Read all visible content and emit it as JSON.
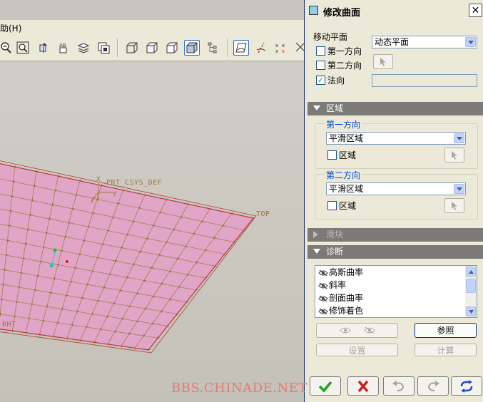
{
  "menubar": {
    "help_menu": "助(H)"
  },
  "toolbar": {
    "icons": [
      "zoom-out-icon",
      "zoom-window-icon",
      "reorient-icon",
      "named-views-icon",
      "layers-icon",
      "view-manager-icon",
      "wireframe-icon",
      "hidden-line-icon",
      "no-hidden-icon",
      "shading-icon",
      "model-tree-icon",
      "datum-planes-icon",
      "datum-axes-icon",
      "datum-points-icon",
      "coordinate-system-icon"
    ],
    "active": "shading-icon"
  },
  "viewport": {
    "labels": {
      "csys": "PRT_CSYS_DEF",
      "top": "TOP",
      "right_partial": "RHT",
      "csys_x": "X",
      "csys_z": "Z",
      "csys_y": "Y"
    },
    "surface_color": "#e0a5c7",
    "edge_color": "#b53b3b"
  },
  "watermark": "BBS.CHINADE.NET",
  "dialog": {
    "title": "修改曲面",
    "move_plane": {
      "label": "移动平面",
      "selected": "动态平面",
      "options": [
        {
          "label": "第一方向",
          "checked": false
        },
        {
          "label": "第二方向",
          "checked": false
        },
        {
          "label": "法向",
          "checked": true
        }
      ]
    },
    "region_section": {
      "title": "区域",
      "expanded": true,
      "dir1": {
        "title": "第一方向",
        "selected": "平滑区域",
        "checkbox_label": "区域",
        "checked": false
      },
      "dir2": {
        "title": "第二方向",
        "selected": "平滑区域",
        "checkbox_label": "区域",
        "checked": false
      }
    },
    "slider_section": {
      "title": "滑块",
      "expanded": false,
      "enabled": false
    },
    "diagnostics_section": {
      "title": "诊断",
      "expanded": true,
      "items": [
        "高斯曲率",
        "斜率",
        "剖面曲率",
        "修饰着色"
      ],
      "buttons": {
        "reference": "参照",
        "settings": "设置",
        "compute": "计算"
      }
    },
    "footer_buttons": [
      "ok-check-icon",
      "cancel-x-icon",
      "undo-icon",
      "redo-icon",
      "refresh-icon"
    ],
    "colors": {
      "ok": "#21a121",
      "cancel": "#c62222",
      "refresh": "#1f4fc6",
      "section_bar": "#7b7a77",
      "group_title": "#0046d5"
    }
  }
}
